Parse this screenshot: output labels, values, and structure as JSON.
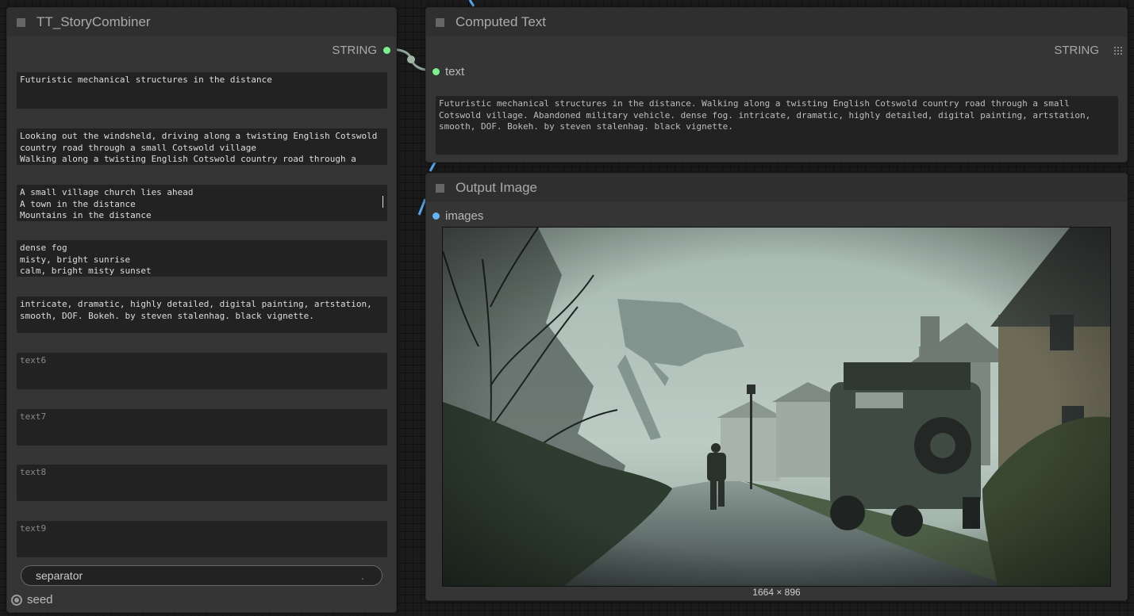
{
  "story_node": {
    "title": "TT_StoryCombiner",
    "output_label": "STRING",
    "fields": [
      {
        "name": "text1",
        "value": "Futuristic mechanical structures in the distance"
      },
      {
        "name": "text2",
        "value": "Looking out the windsheld, driving along a twisting English Cotswold country road through a small Cotswold village\nWalking along a twisting English Cotswold country road through a"
      },
      {
        "name": "text3",
        "value": "A small village church lies ahead\nA town in the distance\nMountains in the distance"
      },
      {
        "name": "text4",
        "value": "dense fog\nmisty, bright sunrise\ncalm, bright misty sunset"
      },
      {
        "name": "text5",
        "value": "intricate, dramatic, highly detailed, digital painting, artstation, smooth, DOF. Bokeh. by steven stalenhag. black vignette."
      },
      {
        "name": "text6",
        "value": "",
        "placeholder": "text6"
      },
      {
        "name": "text7",
        "value": "",
        "placeholder": "text7"
      },
      {
        "name": "text8",
        "value": "",
        "placeholder": "text8"
      },
      {
        "name": "text9",
        "value": "",
        "placeholder": "text9"
      }
    ],
    "separator_label": "separator",
    "separator_value": ".",
    "seed_label": "seed"
  },
  "computed_node": {
    "title": "Computed Text",
    "output_label": "STRING",
    "input_label": "text",
    "value": "Futuristic mechanical structures in the distance. Walking along a twisting English Cotswold country road through a small Cotswold village. Abandoned military vehicle. dense fog. intricate, dramatic, highly detailed, digital painting, artstation, smooth, DOF. Bokeh. by steven stalenhag. black vignette."
  },
  "output_node": {
    "title": "Output Image",
    "input_label": "images",
    "image_dims": "1664 × 896",
    "image_alt": "Misty Cotswold village road with walking figure, military vehicle and distant mechanical structure"
  },
  "colors": {
    "string_slot": "#7cf18e",
    "image_slot": "#64b4f6",
    "link_string": "#9fb8a6",
    "link_image": "#5aa9ee"
  }
}
